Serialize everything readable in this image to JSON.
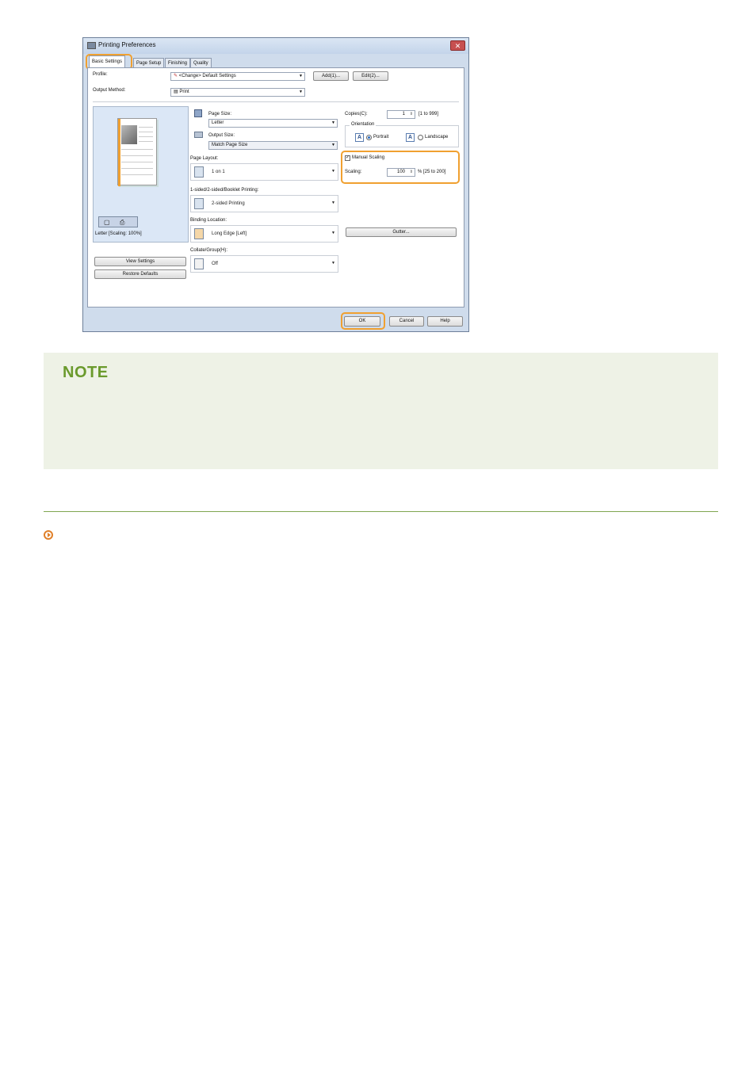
{
  "dialog": {
    "title": "Printing Preferences",
    "close": "✕",
    "tabs": [
      "Basic Settings",
      "Page Setup",
      "Finishing",
      "Quality"
    ],
    "profile_label": "Profile:",
    "profile_value": "<Change> Default Settings",
    "add_button": "Add(1)...",
    "edit_button": "Edit(2)...",
    "output_method_label": "Output Method:",
    "output_method_value": "Print",
    "preview_caption": "Letter [Scaling: 100%]",
    "view_settings_button": "View Settings",
    "restore_defaults_button": "Restore Defaults",
    "page_size_label": "Page Size:",
    "page_size_value": "Letter",
    "output_size_label": "Output Size:",
    "output_size_value": "Match Page Size",
    "page_layout_label": "Page Layout:",
    "page_layout_value": "1 on 1",
    "sided_label": "1-sided/2-sided/Booklet Printing:",
    "sided_value": "2-sided Printing",
    "binding_label": "Binding Location:",
    "binding_value": "Long Edge [Left]",
    "collate_label": "Collate/Group(H):",
    "collate_value": "Off",
    "copies_label": "Copies(C):",
    "copies_value": "1",
    "copies_range": "[1 to 999]",
    "orientation_label": "Orientation",
    "portrait_label": "Portrait",
    "landscape_label": "Landscape",
    "manual_scaling_label": "Manual Scaling",
    "scaling_label": "Scaling:",
    "scaling_value": "100",
    "scaling_range": "% [25 to 200]",
    "gutter_button": "Gutter...",
    "ok_button": "OK",
    "cancel_button": "Cancel",
    "help_button": "Help"
  },
  "note": {
    "title": "NOTE"
  },
  "colors": {
    "highlight": "#f0a030",
    "note_green": "#6a9a2c",
    "note_bg": "#eef2e6"
  }
}
